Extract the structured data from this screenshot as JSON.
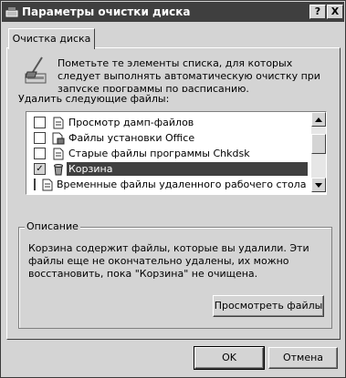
{
  "window": {
    "title": "Параметры очистки диска",
    "help_button": "?",
    "close_button": "X"
  },
  "tab": {
    "label": "Очистка диска"
  },
  "intro": {
    "text": "Пометьте те элементы списка, для которых следует выполнять автоматическую очистку при запуске программы по расписанию."
  },
  "list": {
    "label": "Удалить следующие файлы:",
    "items": [
      {
        "label": "Просмотр дамп-файлов",
        "checked": false,
        "icon": "document-icon"
      },
      {
        "label": "Файлы установки Office",
        "checked": false,
        "icon": "office-icon"
      },
      {
        "label": "Старые файлы программы Chkdsk",
        "checked": false,
        "icon": "document-icon"
      },
      {
        "label": "Корзина",
        "checked": true,
        "selected": true,
        "icon": "recycle-bin-icon"
      },
      {
        "label": "Временные файлы удаленного рабочего стола",
        "checked": false,
        "icon": "document-icon"
      }
    ]
  },
  "description": {
    "title": "Описание",
    "text": "Корзина содержит файлы, которые вы удалили. Эти файлы еще не окончательно удалены, их можно восстановить, пока \"Корзина\" не очищена.",
    "view_files_button": "Просмотреть файлы"
  },
  "buttons": {
    "ok": "OK",
    "cancel": "Отмена"
  }
}
